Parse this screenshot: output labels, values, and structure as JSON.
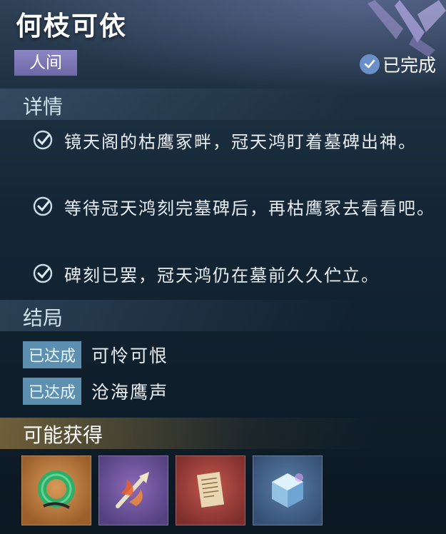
{
  "quest": {
    "title": "何枝可依",
    "world_tag": "人间",
    "status": "已完成"
  },
  "details": {
    "header": "详情",
    "steps": [
      {
        "text": "镜天阁的枯鹰冢畔，冠天鸿盯着墓碑出神。"
      },
      {
        "text": "等待冠天鸿刻完墓碑后，再枯鹰冢去看看吧。"
      },
      {
        "text": "碑刻已罢，冠天鸿仍在墓前久久伫立。"
      }
    ]
  },
  "endings": {
    "header": "结局",
    "items": [
      {
        "badge": "已达成",
        "name": "可怜可恨"
      },
      {
        "badge": "已达成",
        "name": "沧海鹰声"
      }
    ]
  },
  "rewards": {
    "header": "可能获得",
    "items": [
      {
        "icon": "jade-ring-icon",
        "rarity_color": "#c98a4a"
      },
      {
        "icon": "flame-sword-icon",
        "rarity_color": "#7a5fae"
      },
      {
        "icon": "scroll-document-icon",
        "rarity_color": "#b24a45"
      },
      {
        "icon": "crystal-cube-icon",
        "rarity_color": "#4f6f9a"
      }
    ]
  },
  "colors": {
    "world_tag": "#7e78b8",
    "ending_badge": "#5d8fb0",
    "reward_header": "#c39a50"
  }
}
